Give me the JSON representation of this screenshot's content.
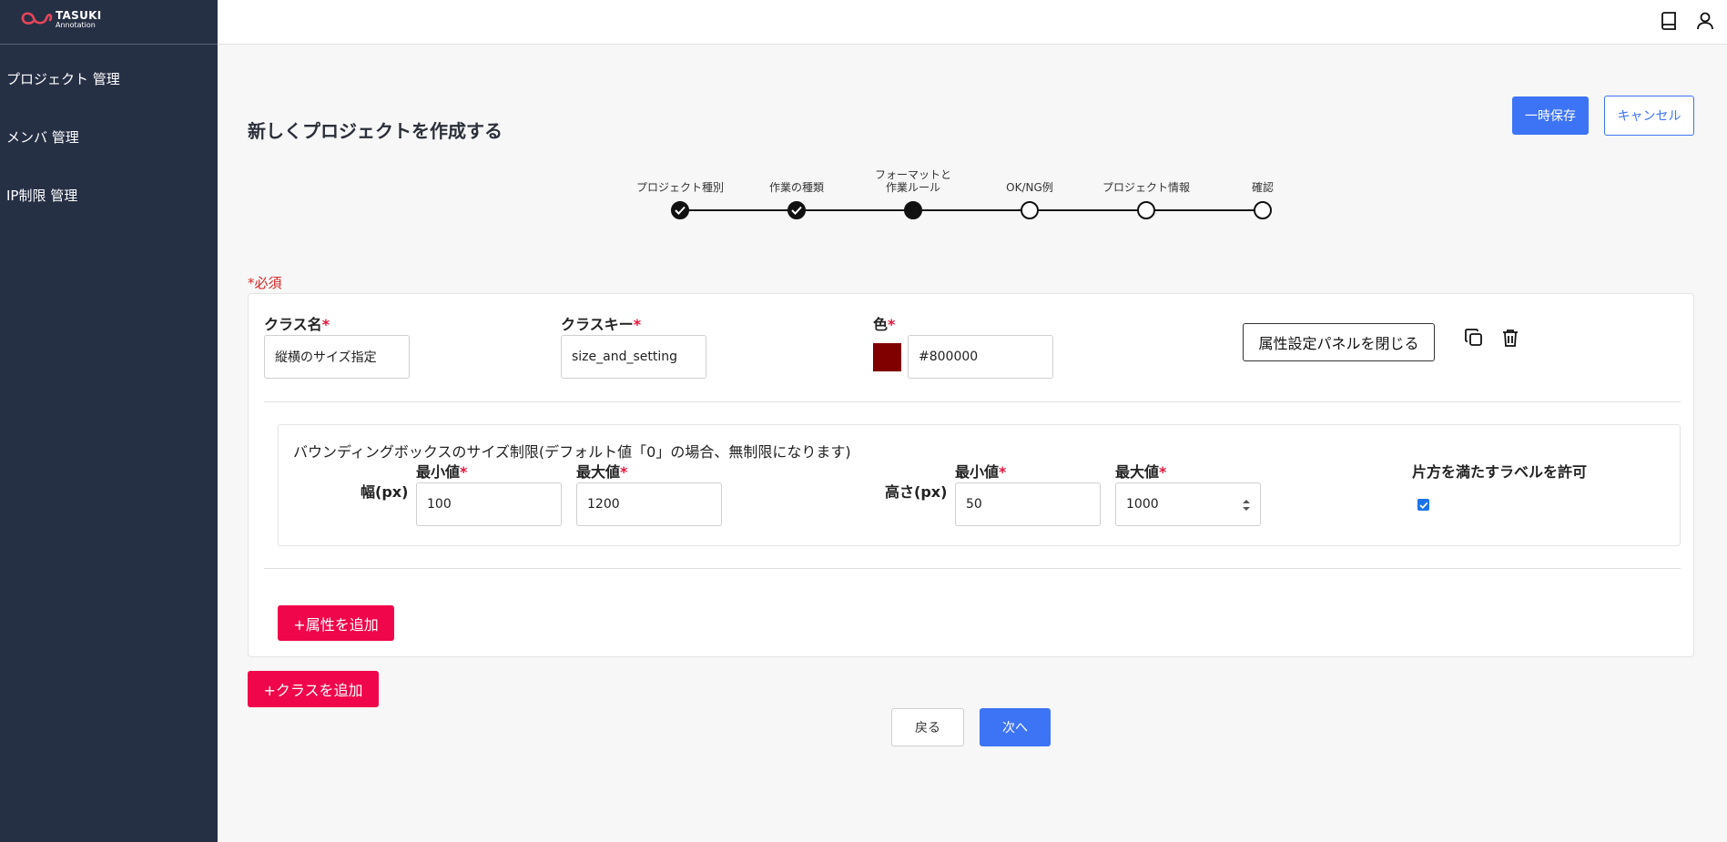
{
  "app": {
    "brand": "TASUKI",
    "brand_sub": "Annotation"
  },
  "sidebar": {
    "items": [
      {
        "label": "プロジェクト 管理"
      },
      {
        "label": "メンバ 管理"
      },
      {
        "label": "IP制限 管理"
      }
    ]
  },
  "topbar": {
    "icons": [
      "book-icon",
      "user-icon"
    ]
  },
  "header": {
    "title": "新しくプロジェクトを作成する",
    "save_label": "一時保存",
    "cancel_label": "キャンセル"
  },
  "stepper": {
    "steps": [
      {
        "label": "プロジェクト種別",
        "state": "done"
      },
      {
        "label": "作業の種類",
        "state": "done"
      },
      {
        "label": "フォーマットと\n作業ルール",
        "label_line1": "フォーマットと",
        "label_line2": "作業ルール",
        "state": "current"
      },
      {
        "label": "OK/NG例",
        "state": "todo"
      },
      {
        "label": "プロジェクト情報",
        "state": "todo"
      },
      {
        "label": "確認",
        "state": "todo"
      }
    ]
  },
  "form": {
    "required_star": "*",
    "required_note": "必須",
    "class_name": {
      "label": "クラス名",
      "value": "縦横のサイズ指定"
    },
    "class_key": {
      "label": "クラスキー",
      "value": "size_and_setting"
    },
    "color": {
      "label": "色",
      "value": "#800000",
      "swatch": "#800000"
    },
    "close_panel_label": "属性設定パネルを閉じる",
    "bbox": {
      "title": "バウンディングボックスのサイズ制限(デフォルト値「0」の場合、無制限になります)",
      "width_label": "幅(px)",
      "height_label": "高さ(px)",
      "min_label": "最小値",
      "max_label": "最大値",
      "width_min": "100",
      "width_max": "1200",
      "height_min": "50",
      "height_max": "1000",
      "allow_label": "片方を満たすラベルを許可",
      "allow_checked": true
    },
    "add_attribute_label": "+属性を追加",
    "add_class_label": "+クラスを追加"
  },
  "footer": {
    "back_label": "戻る",
    "next_label": "次へ"
  },
  "colors": {
    "sidebar_bg": "#263045",
    "primary": "#3d74f5",
    "accent_red": "#f0064a",
    "required_red": "#d62828"
  }
}
